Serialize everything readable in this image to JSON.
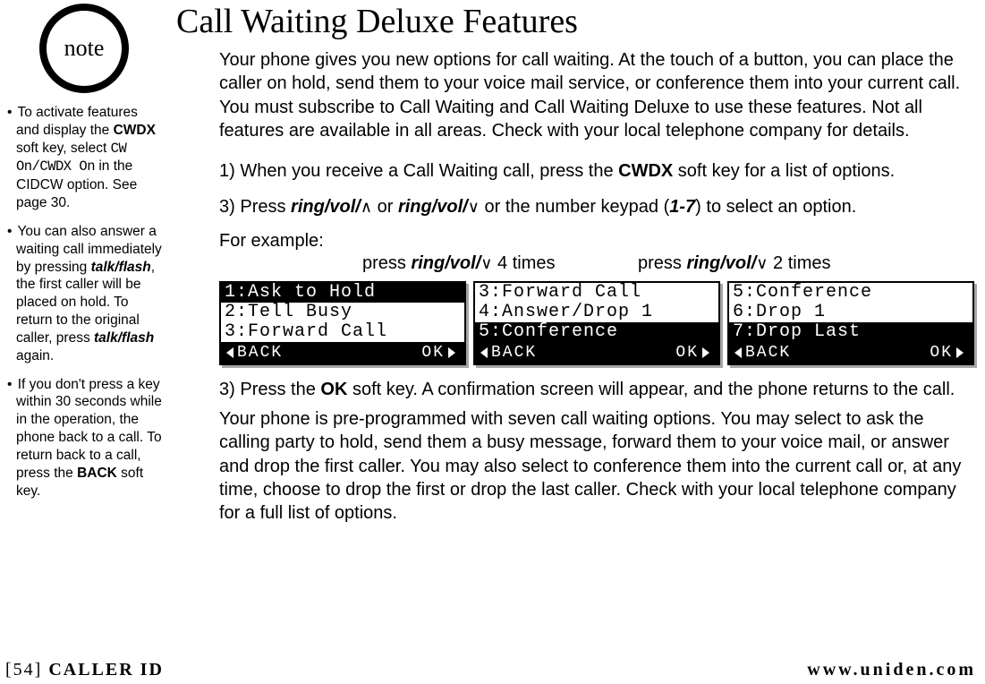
{
  "note_label": "note",
  "side_notes": [
    {
      "pre": "To activate features and display the ",
      "b1": "CWDX",
      "mid": " soft key, select ",
      "mono": "CW On/CWDX On",
      "post": " in the CIDCW option. See page 30."
    },
    {
      "pre": "You can also answer a waiting call immediately by pressing ",
      "bi1": "talk/flash",
      "mid": ", the first caller will be placed on hold. To return to the original caller, press ",
      "bi2": "talk/flash",
      "post": " again."
    },
    {
      "pre": "If you don't press a key within 30 seconds while in the operation, the phone back to a call. To return back to a call, press the ",
      "b1": "BACK",
      "post": " soft key."
    }
  ],
  "title": "Call Waiting Deluxe Features",
  "intro": "Your phone gives you new options for call waiting. At the touch of a button, you can place the caller on hold, send them to your voice mail service, or conference them into your current call. You must subscribe to Call Waiting and Call Waiting Deluxe to use these features. Not all features are available in all areas. Check with your local telephone company for details.",
  "step1": {
    "num": "1)",
    "a": " When you receive a Call Waiting call, press the ",
    "b": "CWDX",
    "c": " soft key for a list of options."
  },
  "step2": {
    "num": "3)",
    "a": " Press ",
    "rv": "ring/vol/",
    "up": "∧",
    "or": " or ",
    "dn": "∨",
    "mid": " or the number keypad (",
    "range": "1-7",
    "end": ") to select an option."
  },
  "example_lead": "For example:",
  "press_labels": {
    "rv": "ring/vol/",
    "dn": "∨",
    "t4": " 4 times",
    "t2": " 2 times",
    "prefix": "press "
  },
  "screens": [
    {
      "lines": [
        {
          "text": "1:Ask to Hold ",
          "sel": true
        },
        {
          "text": "2:Tell Busy",
          "sel": false
        },
        {
          "text": "3:Forward Call",
          "sel": false
        }
      ],
      "back": "BACK",
      "ok": "OK"
    },
    {
      "lines": [
        {
          "text": "3:Forward Call",
          "sel": false
        },
        {
          "text": "4:Answer/Drop 1",
          "sel": false
        },
        {
          "text": "5:Conference  ",
          "sel": true
        }
      ],
      "back": "BACK",
      "ok": "OK"
    },
    {
      "lines": [
        {
          "text": "5:Conference",
          "sel": false
        },
        {
          "text": "6:Drop 1",
          "sel": false
        },
        {
          "text": "7:Drop Last   ",
          "sel": true
        }
      ],
      "back": "BACK",
      "ok": "OK"
    }
  ],
  "step3": {
    "num": "3)",
    "a": " Press the ",
    "b": "OK",
    "c": " soft key. A confirmation screen will appear, and the phone returns to the call."
  },
  "outro": "Your phone is pre-programmed with seven call waiting options. You may select to ask the calling party to hold, send them a busy message, forward them to your voice mail, or answer and drop the first caller. You may also select to conference them into the current call or, at any time, choose to drop the first or drop the last caller. Check with your local telephone company for a full list of options.",
  "footer": {
    "page": "[54]",
    "section": " CALLER ID",
    "url": "www.uniden.com"
  }
}
